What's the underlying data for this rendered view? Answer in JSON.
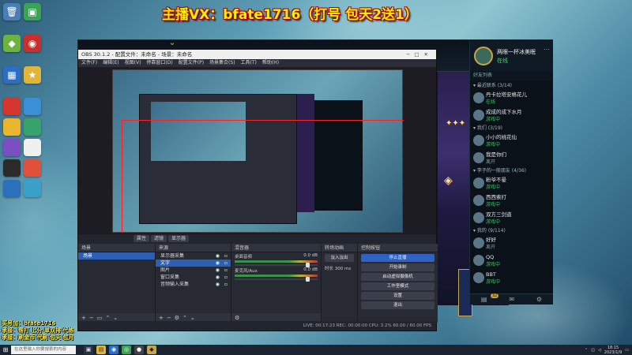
{
  "banner": {
    "text": "主播VX：bfate1716（打号 包天2送1）"
  },
  "desktop": {
    "icons": [
      {
        "name": "recycle-bin-icon",
        "glyph": "🗑",
        "color": "#4a7fb5"
      },
      {
        "name": "app-icon-green",
        "glyph": "▣",
        "color": "#3aa356"
      },
      {
        "name": "nvidia-icon",
        "glyph": "◆",
        "color": "#6cb33f"
      },
      {
        "name": "app-icon-red",
        "glyph": "◉",
        "color": "#c8302e"
      },
      {
        "name": "app-icon-blue",
        "glyph": "▦",
        "color": "#2d6ec4"
      },
      {
        "name": "app-icon-yellow",
        "glyph": "★",
        "color": "#e0b53a"
      }
    ]
  },
  "client": {
    "friends": {
      "user_name": "两眼一杯冰美眠",
      "user_status": "在线",
      "subhead": "好友列表",
      "groups": [
        {
          "label": "▾ 最近联系 (3/14)",
          "rows": [
            {
              "name": "丹卡拉塔安格花儿",
              "status": "在线"
            },
            {
              "name": "成成的成下水月",
              "status": "游戏中"
            }
          ]
        },
        {
          "label": "▾ 我们 (3/19)",
          "rows": [
            {
              "name": "小小的桃花仙",
              "status": "游戏中"
            },
            {
              "name": "我是你们",
              "status": "离开"
            }
          ]
        },
        {
          "label": "▾ 李子的一般朋友 (4/36)",
          "rows": [
            {
              "name": "粉爷不晕",
              "status": "游戏中"
            },
            {
              "name": "西西索打",
              "status": "游戏中"
            },
            {
              "name": "双方三剑道",
              "status": "游戏中"
            }
          ]
        },
        {
          "label": "▾ 我的 (9/114)",
          "rows": [
            {
              "name": "好好",
              "status": "离开"
            },
            {
              "name": "QQ",
              "status": "游戏中"
            },
            {
              "name": "BBT",
              "status": "游戏中"
            }
          ]
        }
      ],
      "badge": "32"
    }
  },
  "obs": {
    "title": "OBS 30.1.2 - 配置文件：未命名 - 场景：未命名",
    "menu": [
      "文件(F)",
      "编辑(E)",
      "视图(V)",
      "停靠窗口(D)",
      "配置文件(P)",
      "场景集合(S)",
      "工具(T)",
      "帮助(H)"
    ],
    "toolbar": [
      "属性",
      "滤镜",
      "显示器"
    ],
    "docks": {
      "scenes": {
        "title": "场景",
        "items": [
          "场景"
        ]
      },
      "sources": {
        "title": "来源",
        "items": [
          "显示器采集",
          "文字",
          "图片",
          "窗口采集",
          "音频输入采集"
        ]
      },
      "mixer": {
        "title": "混音器",
        "channels": [
          {
            "name": "桌面音频",
            "db": "0.0 dB"
          },
          {
            "name": "麦克风/Aux",
            "db": "0.0 dB"
          }
        ]
      },
      "transitions": {
        "title": "转场动画",
        "type": "淡入淡出",
        "duration_label": "时长",
        "duration": "300 ms"
      },
      "controls": {
        "title": "控制按钮",
        "buttons": [
          "停止直播",
          "开始录制",
          "启动虚拟摄像机",
          "工作室模式",
          "设置",
          "退出"
        ]
      }
    },
    "status": "LIVE: 00:17:23   REC: 00:00:00   CPU: 3.2%   60.00 / 60.00 FPS"
  },
  "overlay": {
    "lines": [
      "买号加：bfate1716",
      "承接：帮打 上分 单双排 代练",
      "承接：刷金币 代刷 包天 包月"
    ]
  },
  "taskbar": {
    "search_placeholder": "在这里输入你要搜索的内容",
    "time": "18:15",
    "date": "2023/1/9"
  }
}
